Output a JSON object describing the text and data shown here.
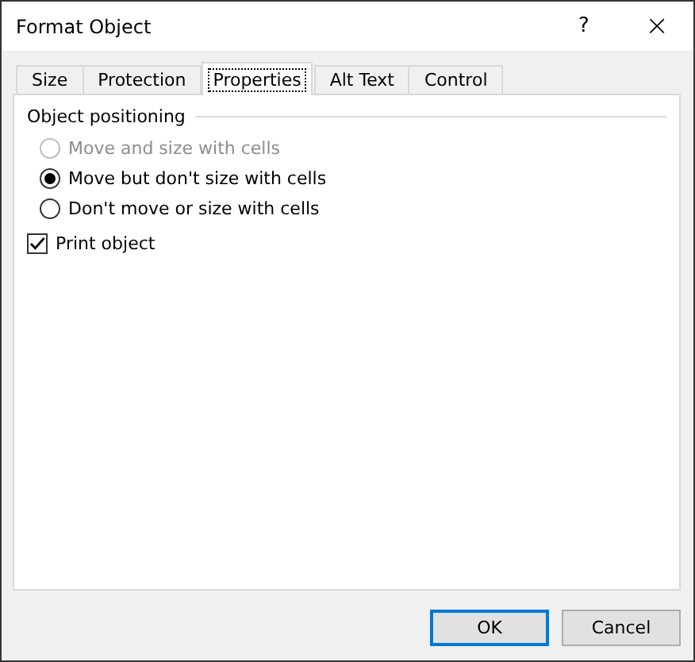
{
  "window": {
    "title": "Format Object",
    "help": "?",
    "close": "×"
  },
  "tabs": [
    {
      "label": "Size",
      "selected": false
    },
    {
      "label": "Protection",
      "selected": false
    },
    {
      "label": "Properties",
      "selected": true
    },
    {
      "label": "Alt Text",
      "selected": false
    },
    {
      "label": "Control",
      "selected": false
    }
  ],
  "group": {
    "title": "Object positioning",
    "options": [
      {
        "label": "Move and size with cells",
        "selected": false,
        "disabled": true
      },
      {
        "label": "Move but don't size with cells",
        "selected": true,
        "disabled": false
      },
      {
        "label": "Don't move or size with cells",
        "selected": false,
        "disabled": false
      }
    ]
  },
  "checkbox": {
    "label": "Print object",
    "checked": true
  },
  "buttons": [
    {
      "label": "OK",
      "default": true
    },
    {
      "label": "Cancel",
      "default": false
    }
  ]
}
